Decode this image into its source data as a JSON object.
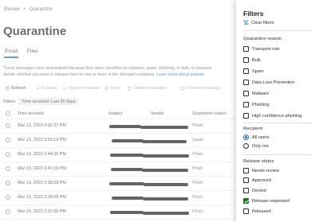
{
  "breadcrumb": {
    "items": [
      "Review",
      "Quarantine"
    ],
    "separator": ">"
  },
  "page": {
    "title": "Quarantine"
  },
  "tabs": [
    {
      "label": "Email",
      "active": true
    },
    {
      "label": "Files",
      "active": false
    }
  ],
  "description": {
    "line1": "These messages were quarantined because they were classified as malware, spam, phishing, or bulk, or because",
    "line2": "decide whether you want to release them to one or more of the intended recipients.",
    "link": "Learn more about quarant"
  },
  "toolbar": {
    "refresh": "Refresh",
    "release": "Release",
    "approve_release": "Approve release",
    "deny": "Deny",
    "delete_messages": "Delete messages",
    "preview_message": "Preview message"
  },
  "filters_bar": {
    "label": "Filters:",
    "chip": "Time received: Last 30 days"
  },
  "table": {
    "columns": [
      "Time received",
      "Subject",
      "Sender",
      "Quarantine reason"
    ],
    "rows": [
      {
        "time": "Mar 13, 2023 4:02:37 PM",
        "reason": "Phish"
      },
      {
        "time": "Mar 13, 2023 3:50:19 PM",
        "reason": "Spam"
      },
      {
        "time": "Mar 13, 2023 3:44:36 PM",
        "reason": "Phish"
      },
      {
        "time": "Mar 13, 2023 3:41:19 PM",
        "reason": "Phish"
      },
      {
        "time": "Mar 13, 2023 3:38:08 PM",
        "reason": "Phish"
      },
      {
        "time": "Mar 13, 2023 3:38:08 PM",
        "reason": "Phish"
      },
      {
        "time": "Mar 13, 2023 3:31:56 PM",
        "reason": "Phish"
      }
    ]
  },
  "filter_panel": {
    "title": "Filters",
    "clear": "Clear filters",
    "quarantine_reason": {
      "title": "Quarantine reason",
      "options": [
        {
          "label": "Transport rule",
          "checked": false
        },
        {
          "label": "Bulk",
          "checked": false
        },
        {
          "label": "Spam",
          "checked": false
        },
        {
          "label": "Data Loss Prevention",
          "checked": false
        },
        {
          "label": "Malware",
          "checked": false
        },
        {
          "label": "Phishing",
          "checked": false
        },
        {
          "label": "High confidence phishing",
          "checked": false
        }
      ]
    },
    "recipient": {
      "title": "Recipient",
      "options": [
        {
          "label": "All users",
          "selected": true
        },
        {
          "label": "Only me",
          "selected": false
        }
      ]
    },
    "release_status": {
      "title": "Release status",
      "options": [
        {
          "label": "Needs review",
          "checked": false
        },
        {
          "label": "Approved",
          "checked": false
        },
        {
          "label": "Denied",
          "checked": false
        },
        {
          "label": "Release requested",
          "checked": true,
          "highlighted": true
        },
        {
          "label": "Released",
          "checked": false
        }
      ]
    }
  },
  "colors": {
    "accent": "#0f6cbd",
    "check": "#107c10",
    "highlight": "#ffff00"
  }
}
